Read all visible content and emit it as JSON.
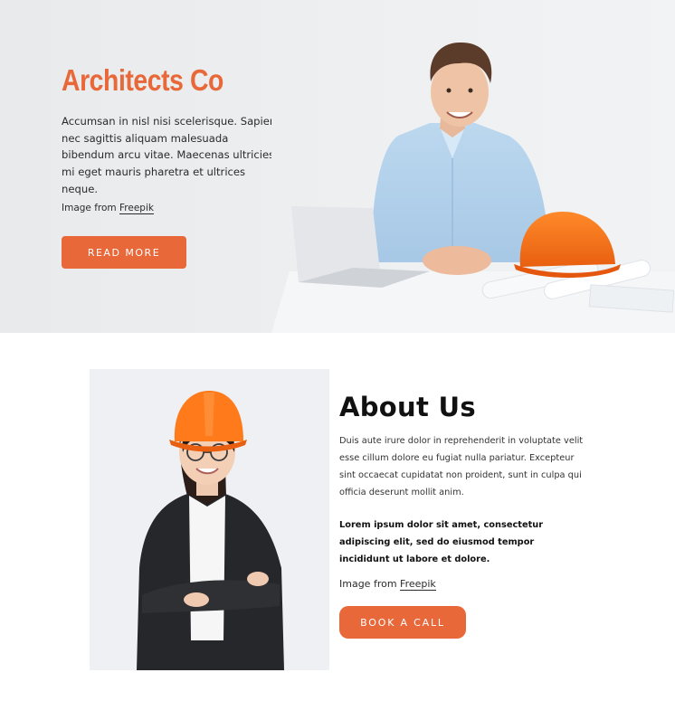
{
  "hero": {
    "title": "Architects Co",
    "text": "Accumsan in nisl nisi scelerisque. Sapien nec sagittis aliquam malesuada bibendum arcu vitae. Maecenas ultricies mi eget mauris pharetra et ultrices neque.",
    "credit_prefix": "Image from ",
    "credit_link": "Freepik",
    "button_label": "READ MORE"
  },
  "about": {
    "title": "About Us",
    "text": "Duis aute irure dolor in reprehenderit in voluptate velit esse cillum dolore eu fugiat nulla pariatur. Excepteur sint occaecat cupidatat non proident, sunt in culpa qui officia deserunt mollit anim.",
    "bold_text": "Lorem ipsum dolor sit amet, consectetur adipiscing elit, sed do eiusmod tempor incididunt ut labore et dolore.",
    "credit_prefix": "Image from ",
    "credit_link": "Freepik",
    "button_label": "BOOK A CALL"
  },
  "colors": {
    "accent": "#e8683a",
    "hero_bg": "#eceef0",
    "text": "#2b2b2b"
  },
  "images": {
    "hero_photo": "man-with-laptop-and-hard-hat-photo",
    "about_photo": "woman-with-hard-hat-photo"
  }
}
